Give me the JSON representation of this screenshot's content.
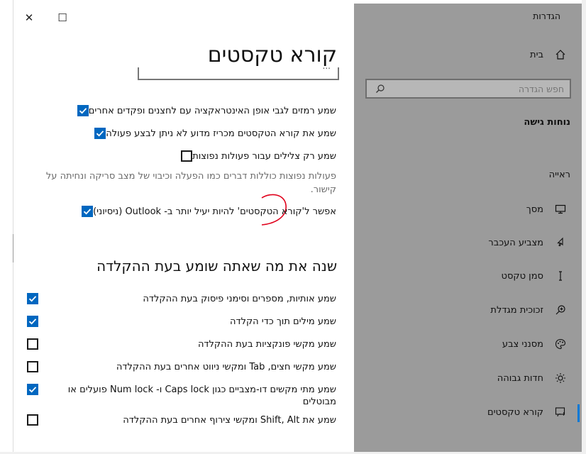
{
  "window": {
    "close_glyph": "✕",
    "maximize_glyph": "☐"
  },
  "sidebar": {
    "app_title": "הגדרות",
    "home_label": "בית",
    "search_placeholder": "חפש הגדרה",
    "section_title": "נוחות גישה",
    "group_label": "ראייה",
    "items": [
      {
        "label": "מסך",
        "icon": "monitor-icon"
      },
      {
        "label": "מצביע העכבר",
        "icon": "mouse-pointer-icon"
      },
      {
        "label": "סמן טקסט",
        "icon": "text-cursor-icon"
      },
      {
        "label": "זכוכית מגדלת",
        "icon": "magnifier-icon"
      },
      {
        "label": "מסנני צבע",
        "icon": "color-filter-icon"
      },
      {
        "label": "חדות גבוהה",
        "icon": "high-contrast-icon"
      },
      {
        "label": "קורא טקסטים",
        "icon": "narrator-icon",
        "selected": true
      }
    ]
  },
  "main": {
    "title": "קורא טקסטים",
    "partial_field_text": "...",
    "options_top": [
      {
        "label": "שמע רמזים לגבי אופן האינטראקציה עם לחצנים ופקדים אחרים",
        "checked": true
      },
      {
        "label": "שמע את קורא הטקסטים מכריז מדוע לא ניתן לבצע פעולה",
        "checked": true
      },
      {
        "label": "שמע רק צלילים עבור פעולות נפוצות",
        "checked": false
      }
    ],
    "info_text": "פעולות נפוצות כוללות דברים כמו הפעלה וכיבוי של מצב סריקה ונחיתה על קישור.",
    "outlook_option": {
      "label": "אפשר ל'קורא הטקסטים' להיות יעיל יותר ב- Outlook (ניסיוני)",
      "checked": true
    },
    "keyboard_heading": "שנה את מה שאתה שומע בעת ההקלדה",
    "keyboard_options": [
      {
        "label": "שמע אותיות, מספרים וסימני פיסוק בעת ההקלדה",
        "checked": true
      },
      {
        "label": "שמע מילים תוך כדי הקלדה",
        "checked": true
      },
      {
        "label": "שמע מקשי פונקציות בעת ההקלדה",
        "checked": false
      },
      {
        "label": "שמע מקשי חצים, Tab ומקשי ניווט אחרים בעת ההקלדה",
        "checked": false
      },
      {
        "label": "שמע מתי מקשים דו-מצביים כגון Caps lock ו- Num lock פועלים או מבוטלים",
        "checked": true
      },
      {
        "label": "שמע את Shift, Alt ומקשי צירוף אחרים בעת ההקלדה",
        "checked": false
      }
    ]
  },
  "colors": {
    "accent": "#0067c0",
    "sidebar_bg": "#9b9b9b",
    "annotation": "#e0001b"
  }
}
